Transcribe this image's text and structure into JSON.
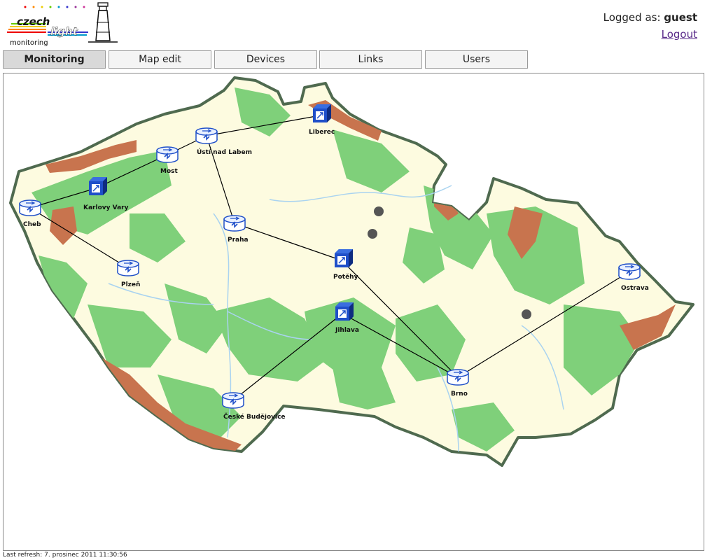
{
  "header": {
    "logo_text_1": "czech",
    "logo_text_2": "light",
    "logo_subtitle": "monitoring",
    "logged_as_label": "Logged as:",
    "username": "guest",
    "logout_label": "Logout"
  },
  "tabs": [
    {
      "label": "Monitoring",
      "active": true
    },
    {
      "label": "Map edit",
      "active": false
    },
    {
      "label": "Devices",
      "active": false
    },
    {
      "label": "Links",
      "active": false
    },
    {
      "label": "Users",
      "active": false
    }
  ],
  "map": {
    "nodes": [
      {
        "id": "cheb",
        "label": "Cheb",
        "type": "router",
        "status": "up"
      },
      {
        "id": "karlovy_vary",
        "label": "Karlovy Vary",
        "type": "switch",
        "status": "up"
      },
      {
        "id": "most",
        "label": "Most",
        "type": "router",
        "status": "up"
      },
      {
        "id": "usti",
        "label": "Ústí nad Labem",
        "type": "router",
        "status": "up"
      },
      {
        "id": "liberec",
        "label": "Liberec",
        "type": "switch",
        "status": "up"
      },
      {
        "id": "praha",
        "label": "Praha",
        "type": "router",
        "status": "up"
      },
      {
        "id": "plzen",
        "label": "Plzeň",
        "type": "router",
        "status": "up"
      },
      {
        "id": "potehy",
        "label": "Potěhy",
        "type": "switch",
        "status": "up"
      },
      {
        "id": "jihlava",
        "label": "Jihlava",
        "type": "switch",
        "status": "up"
      },
      {
        "id": "ceske_budejovice",
        "label": "České Budějovice",
        "type": "router",
        "status": "up"
      },
      {
        "id": "brno",
        "label": "Brno",
        "type": "router",
        "status": "up"
      },
      {
        "id": "ostrava",
        "label": "Ostrava",
        "type": "router",
        "status": "up"
      }
    ],
    "links": [
      [
        "cheb",
        "karlovy_vary"
      ],
      [
        "cheb",
        "plzen"
      ],
      [
        "karlovy_vary",
        "most"
      ],
      [
        "most",
        "usti"
      ],
      [
        "usti",
        "liberec"
      ],
      [
        "usti",
        "praha"
      ],
      [
        "praha",
        "potehy"
      ],
      [
        "potehy",
        "brno"
      ],
      [
        "jihlava",
        "brno"
      ],
      [
        "jihlava",
        "ceske_budejovice"
      ],
      [
        "brno",
        "ostrava"
      ]
    ],
    "colors": {
      "lowland": "#fdfbe0",
      "forest": "#7fd07a",
      "mountain": "#c8744e",
      "border": "#4f6a4f",
      "river": "#a9d3f0",
      "link": "#000000",
      "device_blue": "#1f4fc9"
    }
  },
  "footer": {
    "last_refresh_label": "Last refresh:",
    "last_refresh_value": "7. prosinec 2011 11:30:56"
  }
}
